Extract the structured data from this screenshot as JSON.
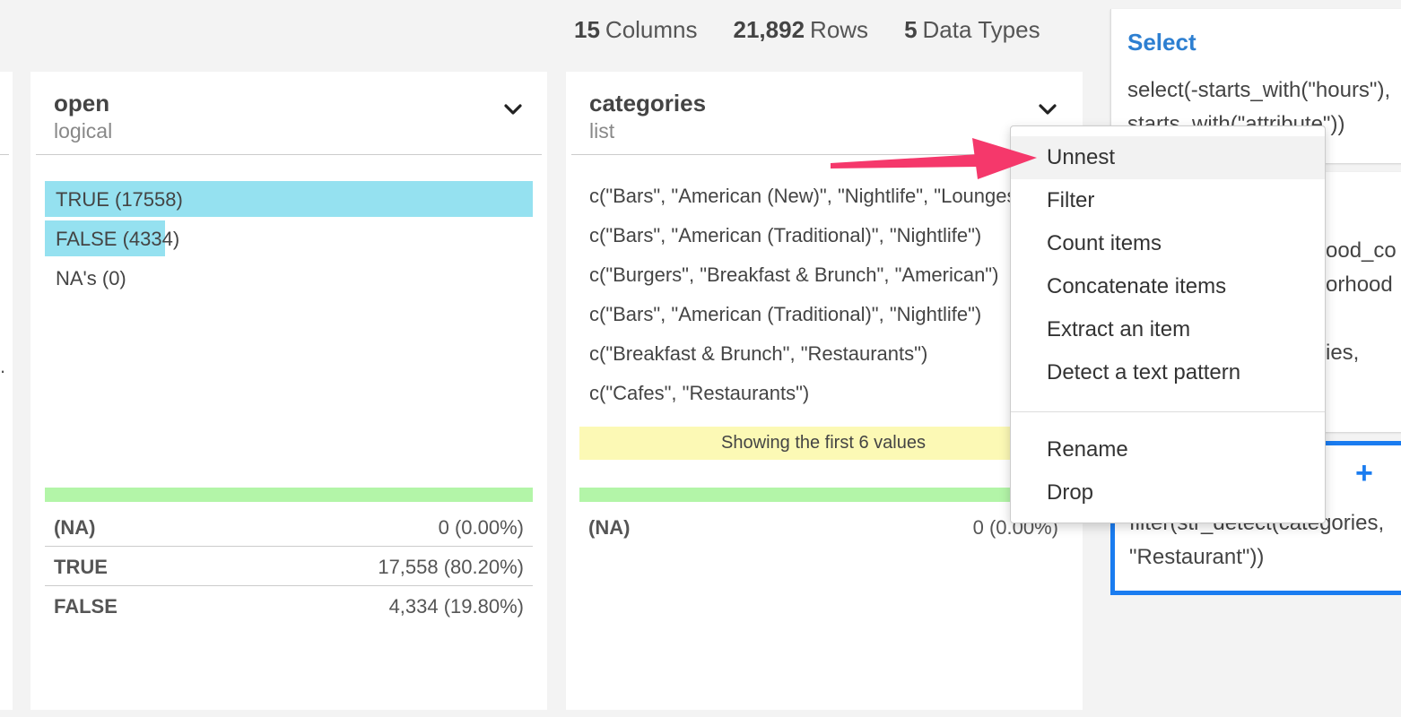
{
  "summary": {
    "columns_num": "15",
    "columns_label": "Columns",
    "rows_num": "21,892",
    "rows_label": "Rows",
    "types_num": "5",
    "types_label": "Data Types"
  },
  "left_edge": {
    "dot": "."
  },
  "open_card": {
    "title": "open",
    "type": "logical",
    "bars": [
      {
        "label": "TRUE (17558)",
        "fraction": 1.0
      },
      {
        "label": "FALSE (4334)",
        "fraction": 0.247
      },
      {
        "label": "NA's (0)",
        "fraction": 0
      }
    ],
    "stats": [
      {
        "key": "(NA)",
        "value": "0 (0.00%)"
      },
      {
        "key": "TRUE",
        "value": "17,558 (80.20%)"
      },
      {
        "key": "FALSE",
        "value": "4,334 (19.80%)"
      }
    ]
  },
  "categories_card": {
    "title": "categories",
    "type": "list",
    "values": [
      "c(\"Bars\", \"American (New)\", \"Nightlife\", \"Lounges\")",
      "c(\"Bars\", \"American (Traditional)\", \"Nightlife\")",
      "c(\"Burgers\", \"Breakfast & Brunch\", \"American\")",
      "c(\"Bars\", \"American (Traditional)\", \"Nightlife\")",
      "c(\"Breakfast & Brunch\", \"Restaurants\")",
      "c(\"Cafes\", \"Restaurants\")"
    ],
    "notice": "Showing the first 6 values",
    "stats": [
      {
        "key": "(NA)",
        "value": "0 (0.00%)"
      }
    ]
  },
  "steps": {
    "select_title": "Select",
    "select_code": "select(-starts_with(\"hours\"),\nstarts_with(\"attribute\"))",
    "mid_fragments": [
      "ood_co",
      "orhood",
      "ies,"
    ],
    "filter_code": "filter(str_detect(categories,\n\"Restaurant\"))"
  },
  "menu": {
    "items": [
      "Unnest",
      "Filter",
      "Count items",
      "Concatenate items",
      "Extract an item",
      "Detect a text pattern"
    ],
    "items2": [
      "Rename",
      "Drop"
    ]
  },
  "colors": {
    "bar": "#95e1f0",
    "green_bar": "#b3f5a8",
    "notice": "#fcf9b5",
    "accent": "#1a7cf0",
    "arrow": "#f5386b"
  }
}
